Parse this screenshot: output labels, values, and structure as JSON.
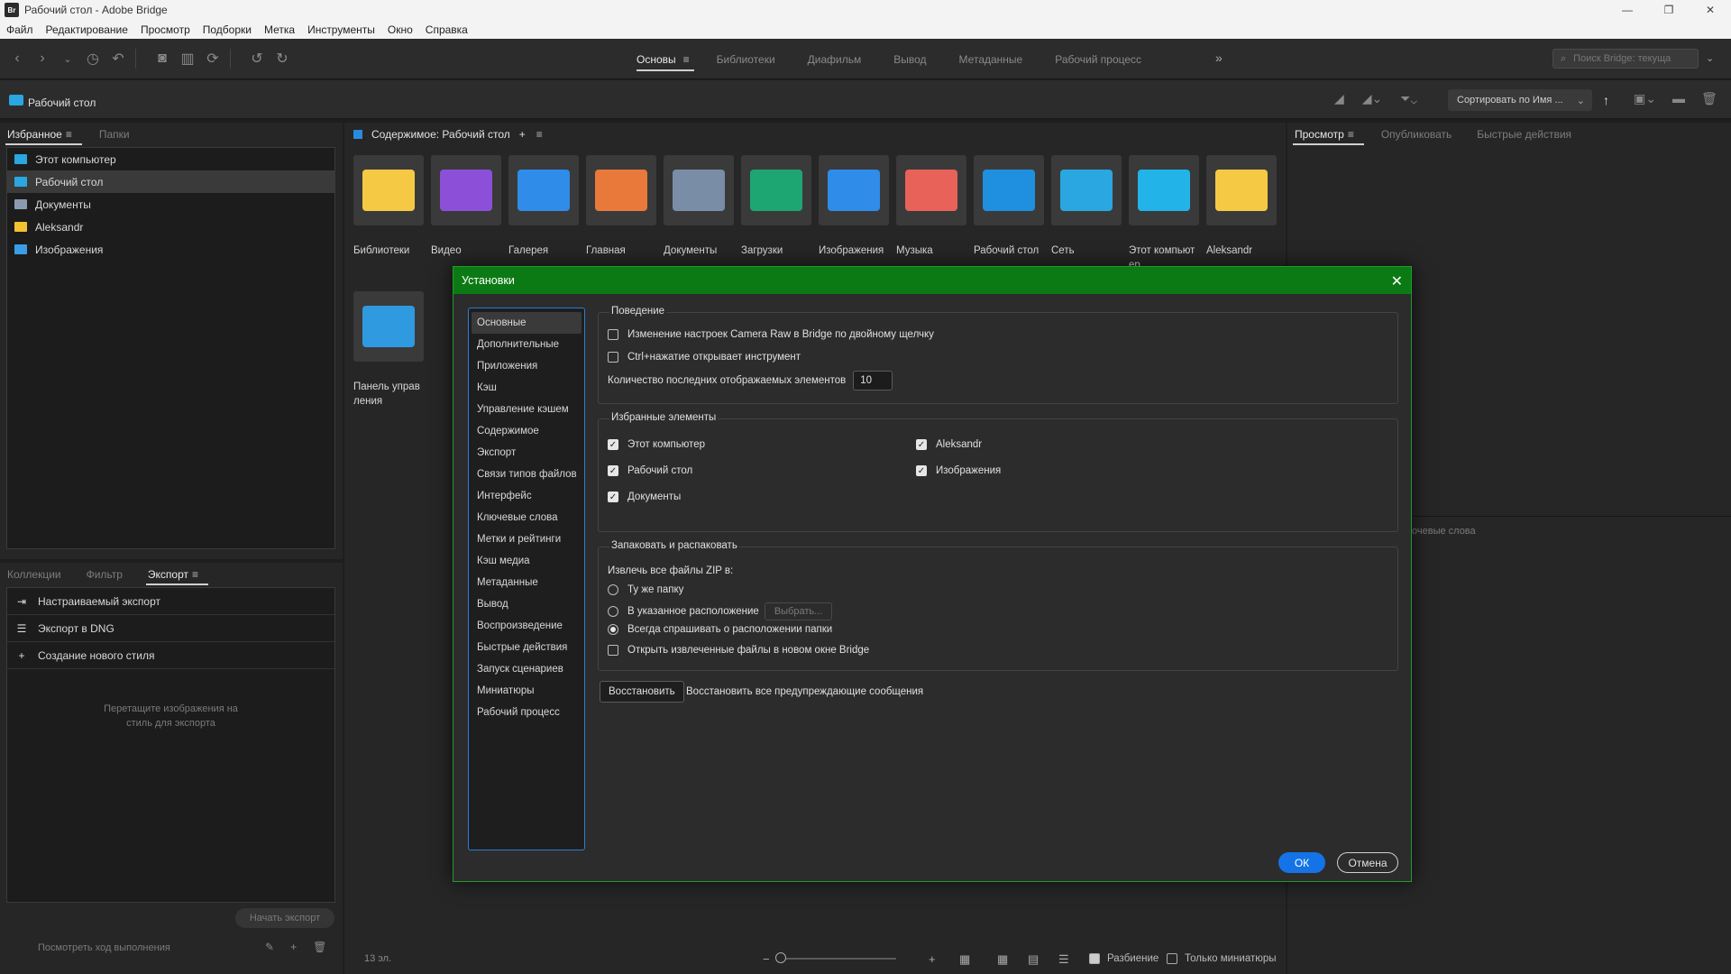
{
  "window": {
    "title": "Рабочий стол - Adobe Bridge",
    "logo_text": "Br",
    "controls": [
      "—",
      "❐",
      "✕"
    ]
  },
  "menu": [
    "Файл",
    "Редактирование",
    "Просмотр",
    "Подборки",
    "Метка",
    "Инструменты",
    "Окно",
    "Справка"
  ],
  "workspaces": {
    "tabs": [
      "Основы",
      "Библиотеки",
      "Диафильм",
      "Вывод",
      "Метаданные",
      "Рабочий процесс"
    ],
    "active": "Основы",
    "more": "»"
  },
  "search": {
    "placeholder": "Поиск Bridge: текуща"
  },
  "pathbar": {
    "path": "Рабочий стол",
    "sort_label": "Сортировать по Имя ..."
  },
  "left_top_panel": {
    "tabs": [
      "Избранное",
      "Папки"
    ],
    "favorites": [
      {
        "label": "Этот компьютер",
        "icon": "computer-icon",
        "color": "#2aa6e0"
      },
      {
        "label": "Рабочий стол",
        "icon": "desktop-folder-icon",
        "color": "#2aa6e0"
      },
      {
        "label": "Документы",
        "icon": "documents-icon",
        "color": "#8a9bb0"
      },
      {
        "label": "Aleksandr",
        "icon": "user-folder-icon",
        "color": "#f2c230"
      },
      {
        "label": "Изображения",
        "icon": "images-icon",
        "color": "#3a9ee6"
      }
    ]
  },
  "left_bottom_panel": {
    "tabs": [
      "Коллекции",
      "Фильтр",
      "Экспорт"
    ],
    "items": [
      {
        "label": "Настраиваемый экспорт",
        "icon": "export-icon",
        "glyph": "⇥"
      },
      {
        "label": "Экспорт в DNG",
        "icon": "list-icon",
        "glyph": "☰"
      },
      {
        "label": "Создание нового стиля",
        "icon": "plus-icon",
        "glyph": "+"
      }
    ],
    "hint_line1": "Перетащите изображения на",
    "hint_line2": "стиль для экспорта",
    "start_button": "Начать экспорт",
    "progress_link": "Посмотреть ход выполнения"
  },
  "content": {
    "title": "Содержимое: Рабочий стол",
    "items": [
      {
        "label": "Библиотеки",
        "icon": "libraries-folder-icon",
        "color": "#f6c945"
      },
      {
        "label": "Видео",
        "icon": "video-folder-icon",
        "color": "#8b4fd8"
      },
      {
        "label": "Галерея",
        "icon": "gallery-icon",
        "color": "#2f8ce8"
      },
      {
        "label": "Главная",
        "icon": "home-icon",
        "color": "#e8793a"
      },
      {
        "label": "Документы",
        "icon": "documents-folder-icon",
        "color": "#7a8da6"
      },
      {
        "label": "Загрузки",
        "icon": "downloads-folder-icon",
        "color": "#1ea672"
      },
      {
        "label": "Изображения",
        "icon": "pictures-folder-icon",
        "color": "#2f8ce8"
      },
      {
        "label": "Музыка",
        "icon": "music-folder-icon",
        "color": "#e8625a"
      },
      {
        "label": "Рабочий стол",
        "icon": "desktop-folder-icon",
        "color": "#1f8fe0"
      },
      {
        "label": "Сеть",
        "icon": "network-icon",
        "color": "#2aa6e0"
      },
      {
        "label": "Этот компьют ер",
        "icon": "this-pc-icon",
        "color": "#22b4e8"
      },
      {
        "label": "Aleksandr",
        "icon": "user-folder-icon",
        "color": "#f6c945"
      },
      {
        "label": "Панель управ ления",
        "icon": "control-panel-icon",
        "color": "#2f9ae0"
      }
    ],
    "status_count": "13 эл.",
    "split_label": "Разбиение",
    "thumbs_only_label": "Только миниатюры"
  },
  "right_panel": {
    "tabs": [
      "Просмотр",
      "Опубликовать",
      "Быстрые действия"
    ],
    "keywords_label": "очевые слова"
  },
  "dialog": {
    "title": "Установки",
    "nav": [
      "Основные",
      "Дополнительные",
      "Приложения",
      "Кэш",
      "Управление кэшем",
      "Содержимое",
      "Экспорт",
      "Связи типов файлов",
      "Интерфейс",
      "Ключевые слова",
      "Метки и рейтинги",
      "Кэш медиа",
      "Метаданные",
      "Вывод",
      "Воспроизведение",
      "Быстрые действия",
      "Запуск сценариев",
      "Миниатюры",
      "Рабочий процесс"
    ],
    "behavior": {
      "title": "Поведение",
      "camera_raw": "Изменение настроек Camera Raw в Bridge по двойному щелчку",
      "ctrl_click": "Ctrl+нажатие открывает инструмент",
      "recent_count_label": "Количество последних отображаемых элементов",
      "recent_count_value": "10"
    },
    "favorites": {
      "title": "Избранные элементы",
      "items": [
        "Этот компьютер",
        "Рабочий стол",
        "Документы",
        "Aleksandr",
        "Изображения"
      ]
    },
    "zip": {
      "title": "Запаковать и распаковать",
      "extract_label": "Извлечь все файлы ZIP в:",
      "same_folder": "Ту же папку",
      "specified": "В указанное расположение",
      "choose_button": "Выбрать...",
      "always_ask": "Всегда спрашивать о расположении папки",
      "open_new_window": "Открыть извлеченные файлы в новом окне Bridge"
    },
    "reset_button": "Восстановить",
    "reset_text": "Восстановить все предупреждающие сообщения",
    "ok": "ОК",
    "cancel": "Отмена"
  }
}
